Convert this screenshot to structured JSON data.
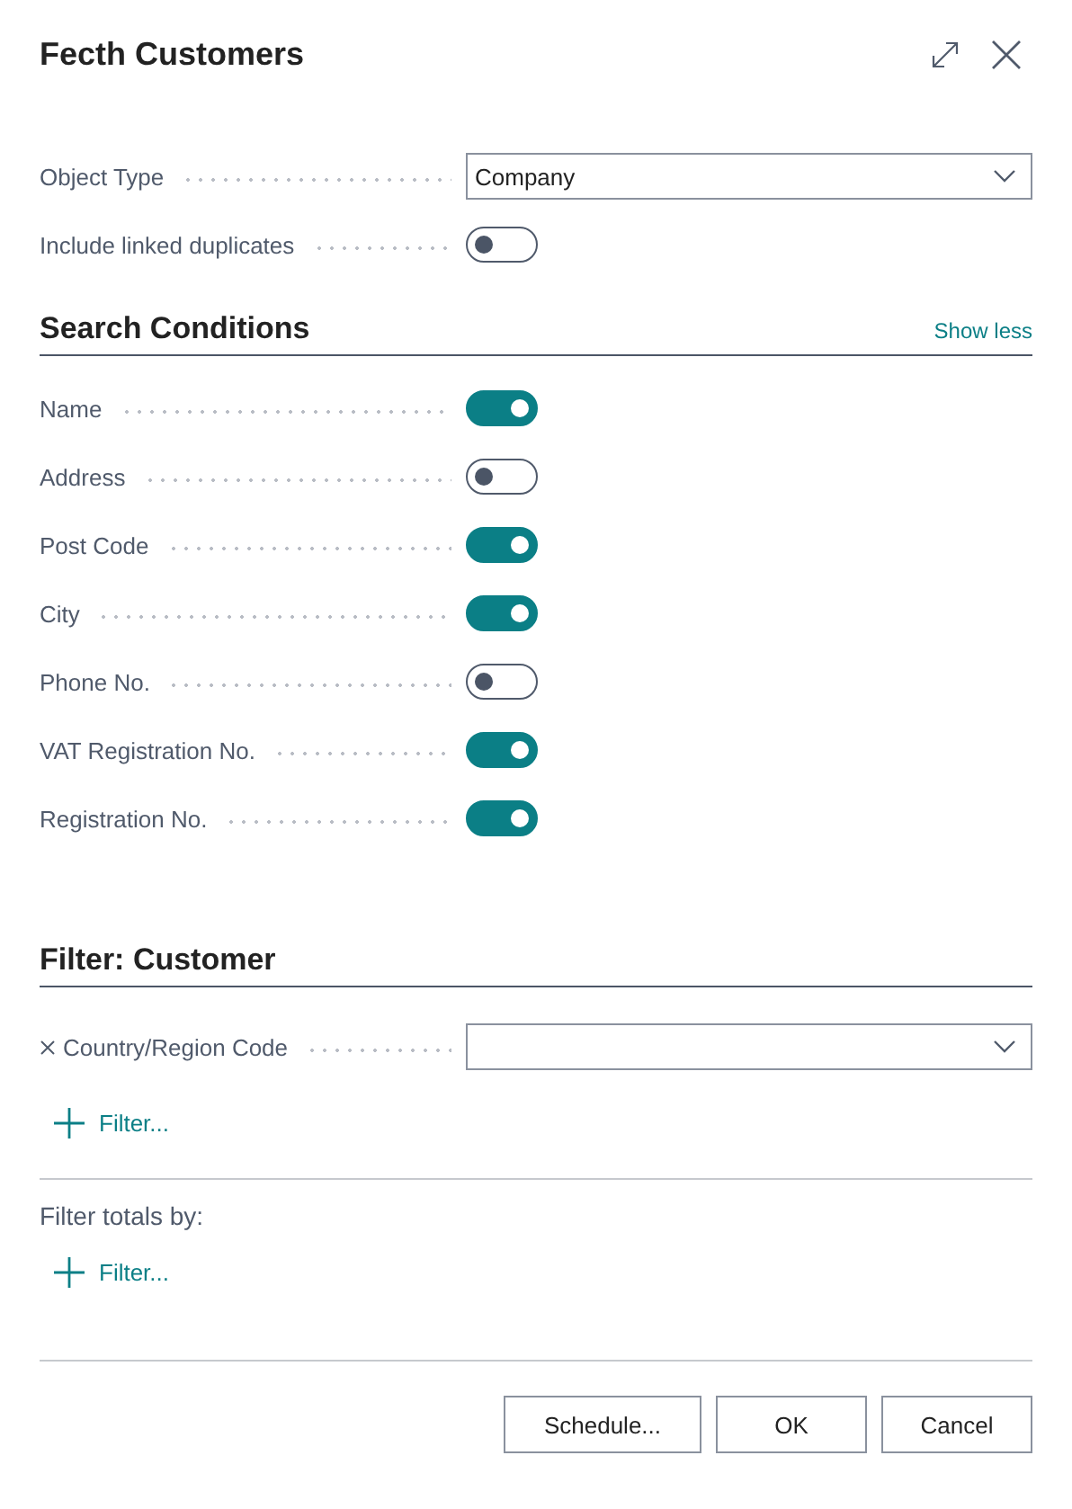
{
  "dialog": {
    "title": "Fecth Customers"
  },
  "fields": [
    {
      "kind": "dropdown",
      "label": "Object Type",
      "value": "Company"
    },
    {
      "kind": "toggle",
      "label": "Include linked duplicates",
      "on": false
    }
  ],
  "search_conditions": {
    "heading": "Search Conditions",
    "toggle_link": "Show less",
    "items": [
      {
        "label": "Name",
        "on": true
      },
      {
        "label": "Address",
        "on": false
      },
      {
        "label": "Post Code",
        "on": true
      },
      {
        "label": "City",
        "on": true
      },
      {
        "label": "Phone No.",
        "on": false
      },
      {
        "label": "VAT Registration No.",
        "on": true
      },
      {
        "label": "Registration No.",
        "on": true
      }
    ]
  },
  "filter_customer": {
    "heading": "Filter: Customer",
    "filters": [
      {
        "label": "Country/Region Code"
      }
    ],
    "add_filter": "Filter..."
  },
  "filter_totals": {
    "label": "Filter totals by:",
    "add_filter": "Filter..."
  },
  "buttons": [
    "Schedule...",
    "OK",
    "Cancel"
  ]
}
